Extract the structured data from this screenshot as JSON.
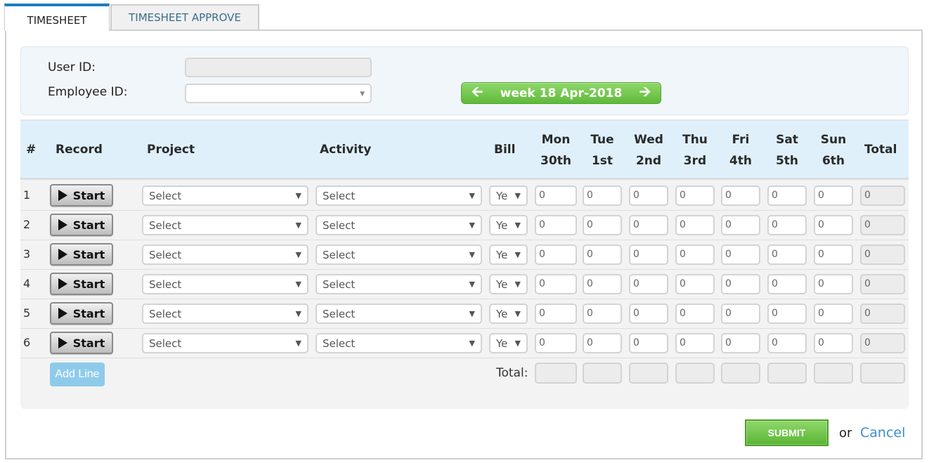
{
  "tabs": [
    {
      "label": "TIMESHEET",
      "active": true
    },
    {
      "label": "TIMESHEET APPROVE",
      "active": false
    }
  ],
  "form": {
    "user_id_label": "User ID:",
    "user_id_value": "",
    "employee_id_label": "Employee ID:",
    "employee_id_value": ""
  },
  "week_nav": {
    "label": "week 18 Apr-2018",
    "prev_icon": "arrow-left-icon",
    "next_icon": "arrow-right-icon"
  },
  "table": {
    "headers": {
      "num": "#",
      "record": "Record",
      "project": "Project",
      "activity": "Activity",
      "bill": "Bill",
      "days": [
        {
          "day": "Mon",
          "date": "30th"
        },
        {
          "day": "Tue",
          "date": "1st"
        },
        {
          "day": "Wed",
          "date": "2nd"
        },
        {
          "day": "Thu",
          "date": "3rd"
        },
        {
          "day": "Fri",
          "date": "4th"
        },
        {
          "day": "Sat",
          "date": "5th"
        },
        {
          "day": "Sun",
          "date": "6th"
        }
      ],
      "total": "Total"
    },
    "rows": [
      {
        "num": "1",
        "record": "Start",
        "project": "Select",
        "activity": "Select",
        "bill": "Ye",
        "hours": [
          "0",
          "0",
          "0",
          "0",
          "0",
          "0",
          "0"
        ],
        "total": "0"
      },
      {
        "num": "2",
        "record": "Start",
        "project": "Select",
        "activity": "Select",
        "bill": "Ye",
        "hours": [
          "0",
          "0",
          "0",
          "0",
          "0",
          "0",
          "0"
        ],
        "total": "0"
      },
      {
        "num": "3",
        "record": "Start",
        "project": "Select",
        "activity": "Select",
        "bill": "Ye",
        "hours": [
          "0",
          "0",
          "0",
          "0",
          "0",
          "0",
          "0"
        ],
        "total": "0"
      },
      {
        "num": "4",
        "record": "Start",
        "project": "Select",
        "activity": "Select",
        "bill": "Ye",
        "hours": [
          "0",
          "0",
          "0",
          "0",
          "0",
          "0",
          "0"
        ],
        "total": "0"
      },
      {
        "num": "5",
        "record": "Start",
        "project": "Select",
        "activity": "Select",
        "bill": "Ye",
        "hours": [
          "0",
          "0",
          "0",
          "0",
          "0",
          "0",
          "0"
        ],
        "total": "0"
      },
      {
        "num": "6",
        "record": "Start",
        "project": "Select",
        "activity": "Select",
        "bill": "Ye",
        "hours": [
          "0",
          "0",
          "0",
          "0",
          "0",
          "0",
          "0"
        ],
        "total": "0"
      }
    ],
    "add_line_label": "Add Line",
    "total_label": "Total:",
    "totals": [
      "",
      "",
      "",
      "",
      "",
      "",
      "",
      ""
    ]
  },
  "actions": {
    "submit_label": "SUBMIT",
    "or_text": "or",
    "cancel_label": "Cancel"
  },
  "colors": {
    "accent_blue": "#1a7fc1",
    "green_button": "#6cc443",
    "header_bg": "#dff0fb",
    "link": "#3a8fc9"
  }
}
